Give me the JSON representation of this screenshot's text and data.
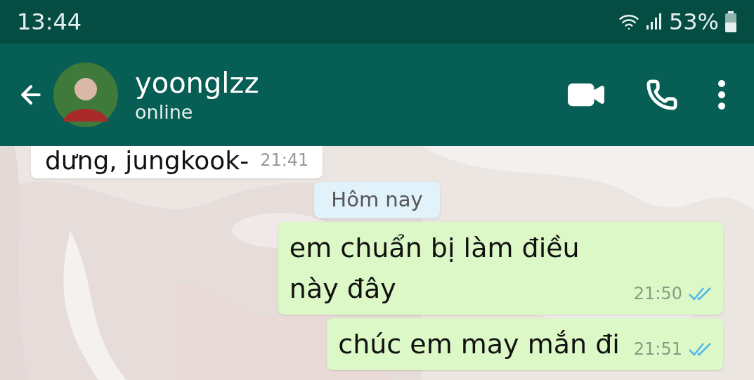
{
  "status_bar": {
    "time": "13:44",
    "battery": "53%"
  },
  "header": {
    "contact_name": "yoonglzz",
    "status": "online"
  },
  "messages": [
    {
      "kind": "incoming",
      "text": "dưng, jungkook-",
      "time": "21:41"
    },
    {
      "kind": "date",
      "text": "Hôm nay"
    },
    {
      "kind": "outgoing",
      "text": "em chuẩn bị làm điều này đây",
      "time": "21:50",
      "read": true
    },
    {
      "kind": "outgoing",
      "text": "chúc em may mắn đi",
      "time": "21:51",
      "read": true
    }
  ]
}
